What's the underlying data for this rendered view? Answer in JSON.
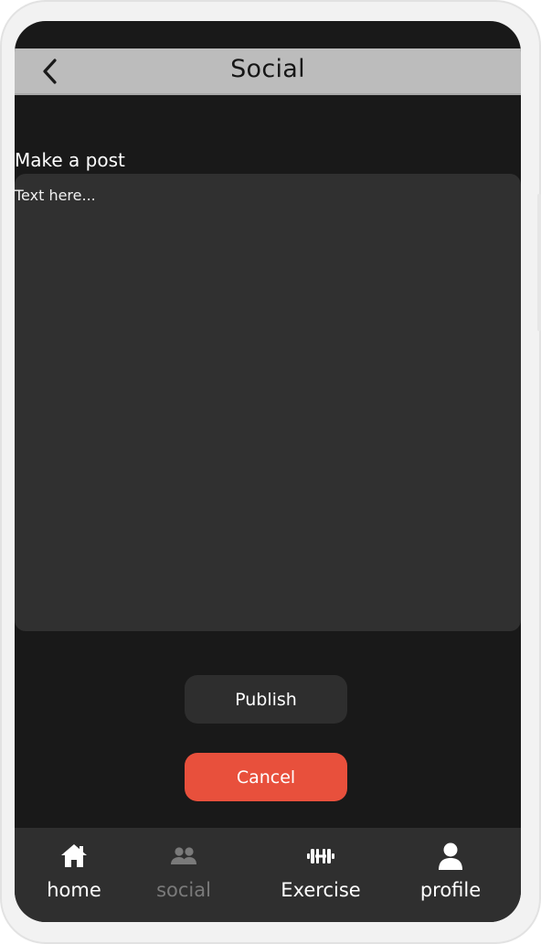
{
  "header": {
    "title": "Social",
    "back_icon": "chevron-left-icon"
  },
  "post": {
    "label": "Make a post",
    "placeholder": "Text here..."
  },
  "actions": {
    "publish_label": "Publish",
    "cancel_label": "Cancel"
  },
  "nav": {
    "items": [
      {
        "label": "home",
        "icon": "home-icon",
        "active": true
      },
      {
        "label": "social",
        "icon": "people-icon",
        "active": false
      },
      {
        "label": "Exercise",
        "icon": "dumbbell-icon",
        "active": true
      },
      {
        "label": "profile",
        "icon": "user-icon",
        "active": true
      }
    ]
  },
  "colors": {
    "background": "#191919",
    "header": "#bcbcbc",
    "surface": "#303030",
    "accent": "#e8503c",
    "inactive": "#7a7a7a"
  }
}
